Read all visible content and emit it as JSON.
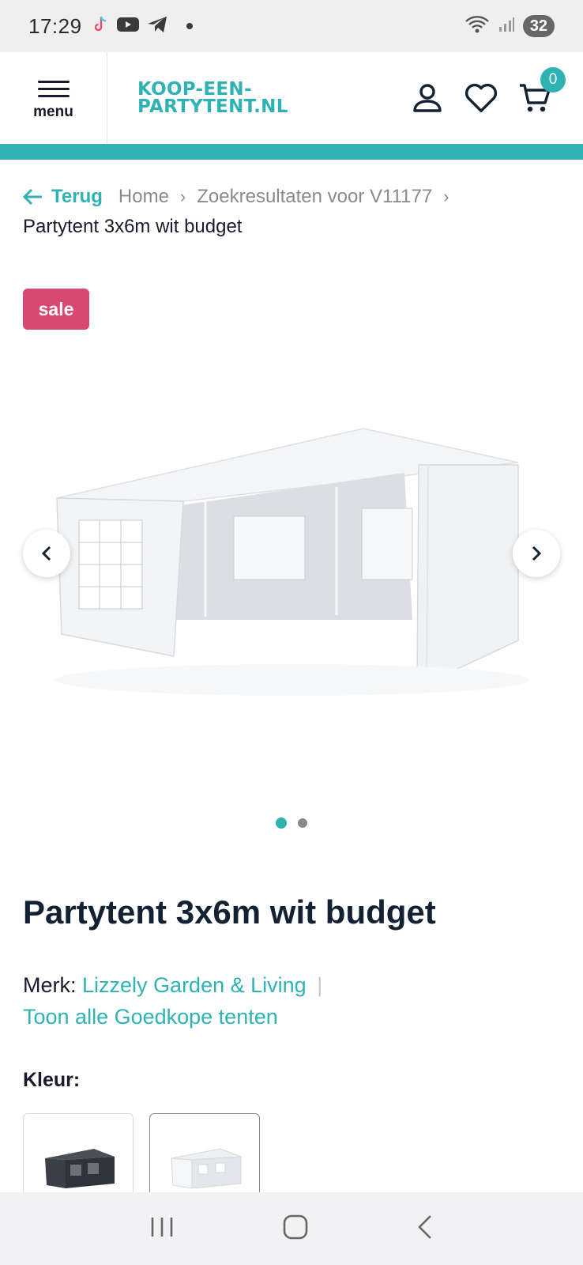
{
  "status_bar": {
    "time": "17:29",
    "battery": "32"
  },
  "header": {
    "menu_label": "menu",
    "logo_line1": "KOOP-EEN-",
    "logo_line2": "PARTYTENT.NL",
    "cart_count": "0",
    "brand_color": "#2fb2b4"
  },
  "breadcrumb": {
    "back_label": "Terug",
    "items": [
      "Home",
      "Zoekresultaten voor V11177"
    ],
    "current": "Partytent 3x6m wit budget"
  },
  "sale_badge": "sale",
  "gallery": {
    "slide_count": 2,
    "active_slide": 1
  },
  "product": {
    "title": "Partytent 3x6m wit budget",
    "brand_prefix": "Merk:",
    "brand_name": "Lizzely Garden & Living",
    "brand_separator": "|",
    "show_all_link": "Toon alle Goedkope tenten",
    "color_label": "Kleur:"
  },
  "colors": {
    "accent": "#2fb2b4",
    "sale": "#d9486f",
    "text": "#142133"
  }
}
